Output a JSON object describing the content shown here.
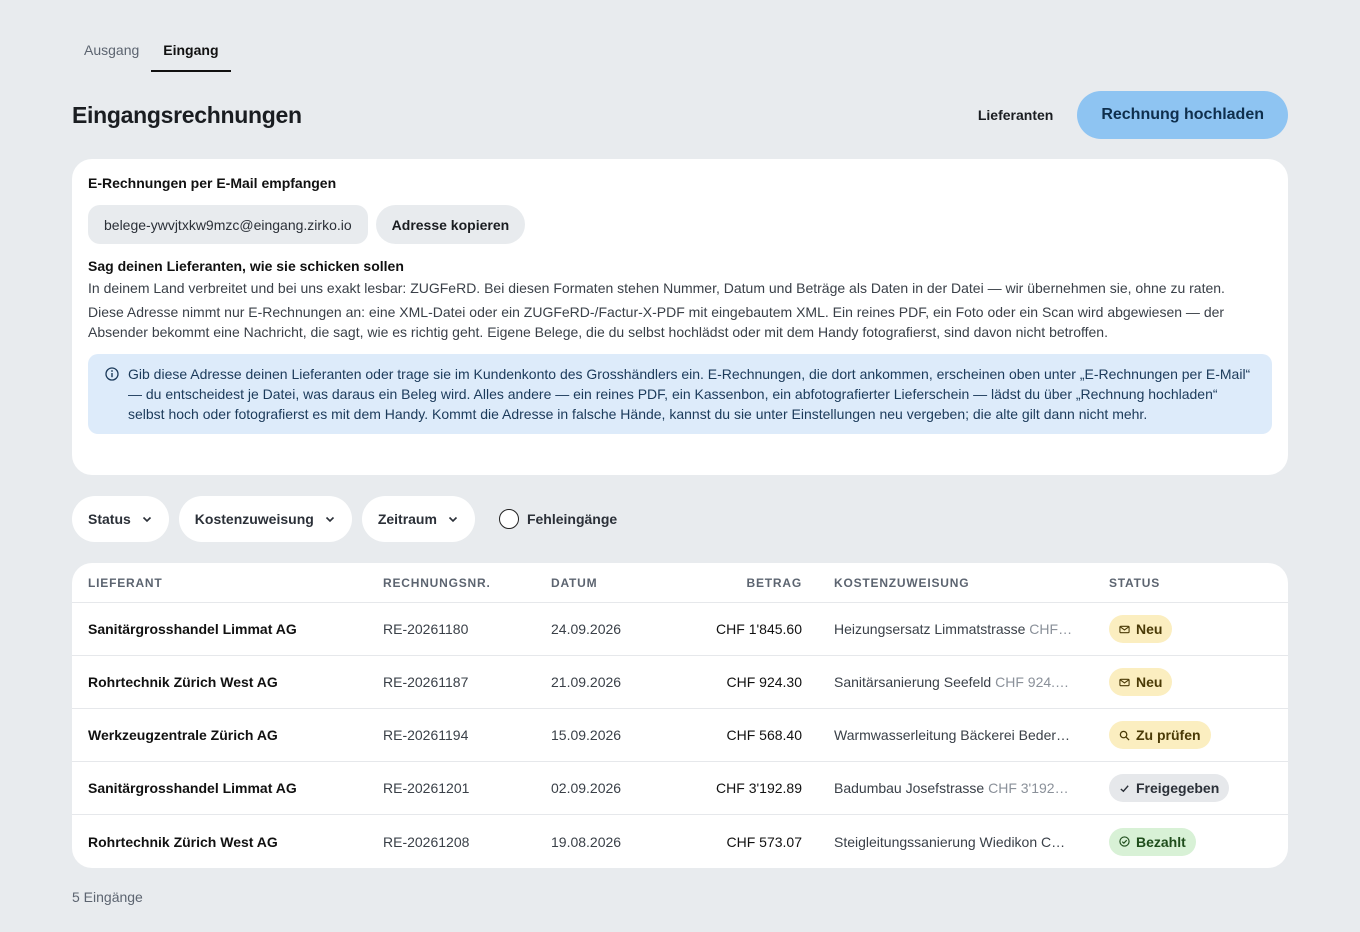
{
  "tabs": [
    {
      "label": "Ausgang",
      "active": false
    },
    {
      "label": "Eingang",
      "active": true
    }
  ],
  "header": {
    "title": "Eingangsrechnungen",
    "suppliers_link": "Lieferanten",
    "upload_button": "Rechnung hochladen"
  },
  "email_card": {
    "title": "E-Rechnungen per E-Mail empfangen",
    "address": "belege-ywvjtxkw9mzc@eingang.zirko.io",
    "copy_button": "Adresse kopieren",
    "subtitle": "Sag deinen Lieferanten, wie sie schicken sollen",
    "paragraph1": "In deinem Land verbreitet und bei uns exakt lesbar: ZUGFeRD. Bei diesen Formaten stehen Nummer, Datum und Beträge als Daten in der Datei — wir übernehmen sie, ohne zu raten.",
    "paragraph2": "Diese Adresse nimmt nur E-Rechnungen an: eine XML-Datei oder ein ZUGFeRD-/Factur-X-PDF mit eingebautem XML. Ein reines PDF, ein Foto oder ein Scan wird abgewiesen — der Absender bekommt eine Nachricht, die sagt, wie es richtig geht. Eigene Belege, die du selbst hochlädst oder mit dem Handy fotografierst, sind davon nicht betroffen.",
    "info": "Gib diese Adresse deinen Lieferanten oder trage sie im Kundenkonto des Grosshändlers ein. E-Rechnungen, die dort ankommen, erscheinen oben unter „E-Rechnungen per E-Mail“ — du entscheidest je Datei, was daraus ein Beleg wird. Alles andere — ein reines PDF, ein Kassenbon, ein abfotografierter Lieferschein — lädst du über „Rechnung hochladen“ selbst hoch oder fotografierst es mit dem Handy. Kommt die Adresse in falsche Hände, kannst du sie unter Einstellungen neu vergeben; die alte gilt dann nicht mehr."
  },
  "filters": {
    "status": "Status",
    "cost": "Kostenzuweisung",
    "period": "Zeitraum",
    "missing": "Fehleingänge",
    "missing_checked": false
  },
  "table": {
    "headers": {
      "supplier": "LIEFERANT",
      "number": "RECHNUNGSNR.",
      "date": "DATUM",
      "amount": "BETRAG",
      "assignment": "KOSTENZUWEISUNG",
      "status": "STATUS"
    },
    "rows": [
      {
        "supplier": "Sanitärgrosshandel Limmat AG",
        "number": "RE-20261180",
        "date": "24.09.2026",
        "amount": "CHF 1'845.60",
        "assignment": "Heizungsersatz Limmatstrasse",
        "assignment_amount": "CHF…",
        "status": "Neu",
        "status_icon": "mail-icon"
      },
      {
        "supplier": "Rohrtechnik Zürich West AG",
        "number": "RE-20261187",
        "date": "21.09.2026",
        "amount": "CHF 924.30",
        "assignment": "Sanitärsanierung Seefeld",
        "assignment_amount": "CHF 924.…",
        "status": "Neu",
        "status_icon": "mail-icon"
      },
      {
        "supplier": "Werkzeugzentrale Zürich AG",
        "number": "RE-20261194",
        "date": "15.09.2026",
        "amount": "CHF 568.40",
        "assignment": "Warmwasserleitung Bäckerei Beder…",
        "assignment_amount": "",
        "status": "Zu prüfen",
        "status_icon": "search-icon"
      },
      {
        "supplier": "Sanitärgrosshandel Limmat AG",
        "number": "RE-20261201",
        "date": "02.09.2026",
        "amount": "CHF 3'192.89",
        "assignment": "Badumbau Josefstrasse",
        "assignment_amount": "CHF 3'192…",
        "status": "Freigegeben",
        "status_icon": "check-icon"
      },
      {
        "supplier": "Rohrtechnik Zürich West AG",
        "number": "RE-20261208",
        "date": "19.08.2026",
        "amount": "CHF 573.07",
        "assignment": "Steigleitungssanierung Wiedikon C…",
        "assignment_amount": "",
        "status": "Bezahlt",
        "status_icon": "check-circle-icon"
      }
    ]
  },
  "footer": {
    "count": "5 Eingänge"
  }
}
